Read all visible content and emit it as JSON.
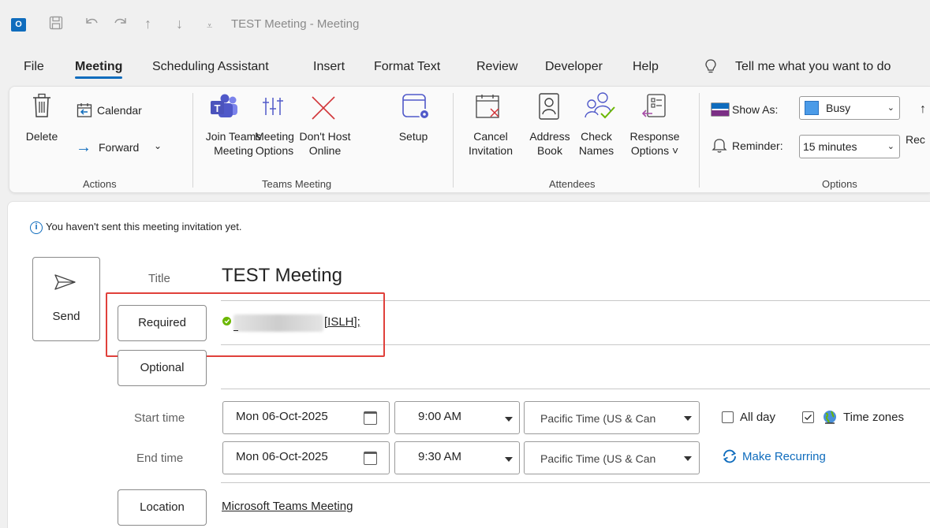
{
  "window": {
    "title": "TEST Meeting  -  Meeting",
    "app_icon": "outlook-icon",
    "qat_icons": [
      "save-icon",
      "undo-icon",
      "redo-icon",
      "up-arrow-icon",
      "down-arrow-icon",
      "customize-qat-icon"
    ]
  },
  "menu": {
    "tabs": [
      "File",
      "Meeting",
      "Scheduling Assistant",
      "Insert",
      "Format Text",
      "Review",
      "Developer",
      "Help"
    ],
    "active": "Meeting",
    "tell_me": "Tell me what you want to do"
  },
  "ribbon": {
    "actions": {
      "label": "Actions",
      "delete": "Delete",
      "calendar": "Calendar",
      "forward": "Forward"
    },
    "teams": {
      "label": "Teams Meeting",
      "join_l1": "Join Teams",
      "join_l2": "Meeting",
      "options_l1": "Meeting",
      "options_l2": "Options",
      "nohost_l1": "Don't Host",
      "nohost_l2": "Online",
      "setup": "Setup"
    },
    "attendees": {
      "label": "Attendees",
      "cancel_l1": "Cancel",
      "cancel_l2": "Invitation",
      "address_l1": "Address",
      "address_l2": "Book",
      "check_l1": "Check",
      "check_l2": "Names",
      "response_l1": "Response",
      "response_l2": "Options ˅"
    },
    "options": {
      "label": "Options",
      "show_as_label": "Show As:",
      "show_as_value": "Busy",
      "reminder_label": "Reminder:",
      "reminder_value": "15 minutes",
      "rec_partial": "Rec"
    }
  },
  "form": {
    "info": "You haven't sent this meeting invitation yet.",
    "send": "Send",
    "title_label": "Title",
    "title_value": "TEST Meeting",
    "required_btn": "Required",
    "required_value": "[ISLH];",
    "optional_btn": "Optional",
    "start_label": "Start time",
    "start_date": "Mon 06-Oct-2025",
    "start_time": "9:00 AM",
    "start_tz": "Pacific Time (US & Can",
    "end_label": "End time",
    "end_date": "Mon 06-Oct-2025",
    "end_time": "9:30 AM",
    "end_tz": "Pacific Time (US & Can",
    "all_day": "All day",
    "all_day_checked": false,
    "time_zones": "Time zones",
    "time_zones_checked": true,
    "make_recurring": "Make Recurring",
    "location_btn": "Location",
    "location_value": "Microsoft Teams Meeting"
  },
  "colors": {
    "accent": "#0f6cbd",
    "highlight": "#e0403b",
    "busy": "#4b9be8",
    "presence_available": "#6bb700"
  }
}
